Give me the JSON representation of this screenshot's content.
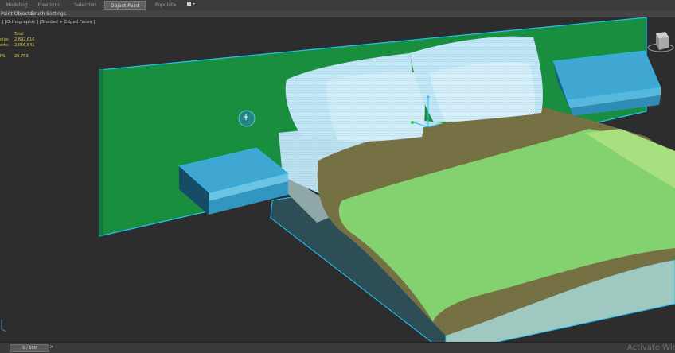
{
  "ribbon": {
    "tabs": [
      {
        "label": "Modeling",
        "active": false
      },
      {
        "label": "Freeform",
        "active": false
      },
      {
        "label": "Selection",
        "active": false
      },
      {
        "label": "Object Paint",
        "active": true
      },
      {
        "label": "Populate",
        "active": false
      }
    ],
    "extra_icon": "camera-dropdown-icon"
  },
  "toolbar": {
    "paint_objects": "Paint Objects",
    "brush_settings": "Brush Settings"
  },
  "viewport": {
    "label": "] [Orthographic ] [Shaded + Edged Faces ]",
    "stats": {
      "header": "Total",
      "polys_label": "olys:",
      "polys_value": "2,892,616",
      "verts_label": "erts:",
      "verts_value": "2,066,541",
      "fps_label": "PS:",
      "fps_value": "29.753"
    },
    "colors": {
      "headboard": "#1a8e3f",
      "wireframe": "#1fc4ff",
      "nightstand": "#3fa7d1",
      "duvet": "#7fd06a",
      "blanket": "#7a7648",
      "pillow": "#cfeefb",
      "bed_base": "#9ec8c0"
    }
  },
  "timeline": {
    "frame": "0 / 100",
    "next_glyph": ">"
  },
  "watermark": "Activate Wind"
}
